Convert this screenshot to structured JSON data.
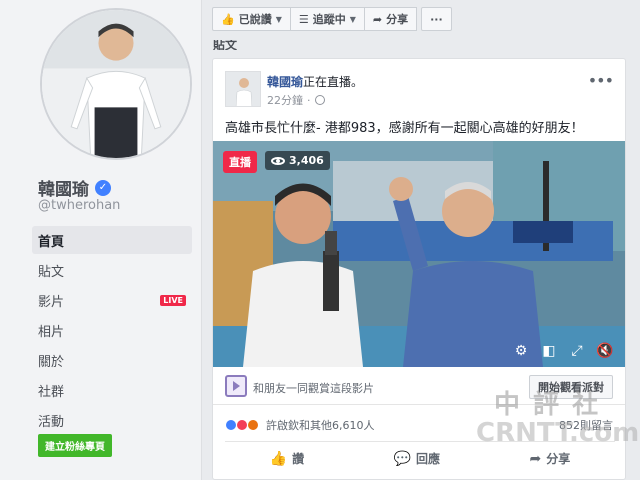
{
  "sidebar": {
    "page_name": "韓國瑜",
    "handle": "@twherohan",
    "items": [
      {
        "label": "首頁",
        "active": true
      },
      {
        "label": "貼文",
        "active": false
      },
      {
        "label": "影片",
        "active": false,
        "badge": "LIVE"
      },
      {
        "label": "相片",
        "active": false
      },
      {
        "label": "關於",
        "active": false
      },
      {
        "label": "社群",
        "active": false
      },
      {
        "label": "活動",
        "active": false
      }
    ],
    "create_page": "建立粉絲專頁"
  },
  "actionbar": {
    "liked": "已說讚",
    "following": "追蹤中",
    "share": "分享",
    "more": "···"
  },
  "section_label": "貼文",
  "post": {
    "author": "韓國瑜",
    "status": "正在直播。",
    "time": "22分鐘",
    "text": "高雄市長忙什麼- 港都983，感謝所有一起關心高雄的好朋友！",
    "video": {
      "live_label": "直播",
      "viewers": "3,406"
    },
    "watch_text": "和朋友一同觀賞這段影片",
    "start_watch": "開始觀看派對",
    "reactions_text": "許啟欽和其他6,610人",
    "comments": "852則留言",
    "actions": {
      "like": "讚",
      "comment": "回應",
      "share": "分享"
    }
  },
  "watermark": {
    "line1": "中 評 社",
    "line2": "CRNTT.com"
  },
  "colors": {
    "brand": "#4267b2",
    "live": "#f02849",
    "create_page": "#42b72a"
  }
}
